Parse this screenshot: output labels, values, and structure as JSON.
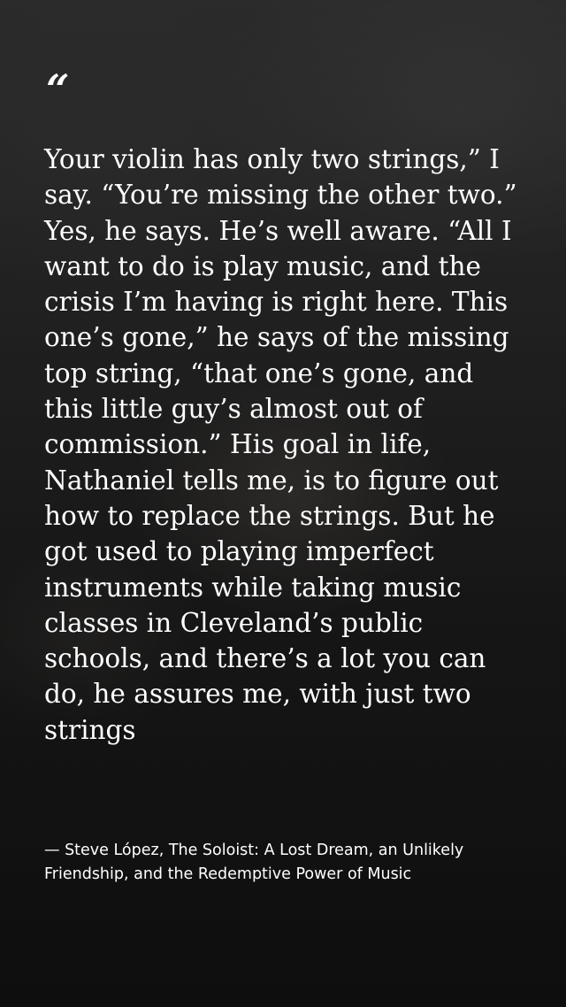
{
  "quote": {
    "open_mark": "“",
    "text": "Your violin has only two strings,” I say. “You’re missing the other two.” Yes, he says. He’s well aware. “All I want to do is play music, and the crisis I’m having is right here. This one’s gone,” he says of the missing top string, “that one’s gone, and this little guy’s almost out of commission.” His goal in life, Nathaniel tells me, is to figure out how to replace the strings. But he got used to playing imperfect instruments while taking music classes in Cleveland’s public schools, and there’s a lot you can do, he assures me, with just two strings",
    "attribution": "— Steve López, The Soloist: A Lost Dream, an Unlikely Friendship, and the Redemptive Power of Music"
  },
  "colors": {
    "text": "#ffffff",
    "background": "#1e1e1e"
  }
}
